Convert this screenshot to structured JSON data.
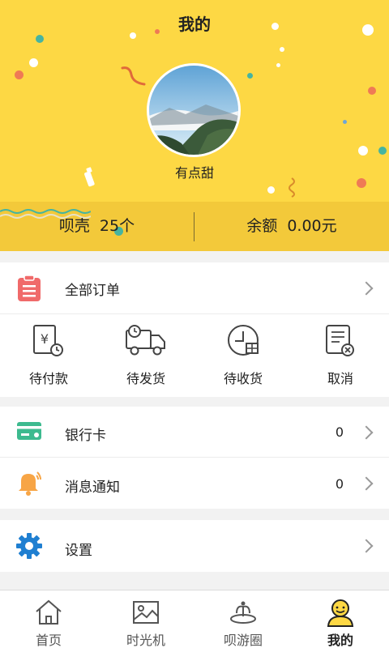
{
  "header": {
    "title": "我的",
    "username": "有点甜"
  },
  "stats": {
    "shells_label": "呗壳",
    "shells_value": "25个",
    "balance_label": "余额",
    "balance_value": "0.00元"
  },
  "orders": {
    "all_label": "全部订单",
    "items": [
      {
        "label": "待付款",
        "icon": "pending-payment-icon"
      },
      {
        "label": "待发货",
        "icon": "truck-icon"
      },
      {
        "label": "待收货",
        "icon": "clock-package-icon"
      },
      {
        "label": "取消",
        "icon": "cancel-doc-icon"
      }
    ]
  },
  "menu": {
    "bank_card": {
      "label": "银行卡",
      "count": "0"
    },
    "notifications": {
      "label": "消息通知",
      "count": "0"
    },
    "settings": {
      "label": "设置"
    }
  },
  "nav": {
    "items": [
      {
        "label": "首页",
        "icon": "home-icon"
      },
      {
        "label": "时光机",
        "icon": "image-icon"
      },
      {
        "label": "呗游圈",
        "icon": "fountain-icon"
      },
      {
        "label": "我的",
        "icon": "user-smile-icon"
      }
    ],
    "active": "我的"
  },
  "colors": {
    "header_bg": "#fdd844",
    "stats_bg": "#f3c93a",
    "order_icon": "#f06a6a",
    "bank_icon": "#3dba8f",
    "bell_icon": "#f7a546",
    "gear_icon": "#1f7fd1"
  }
}
